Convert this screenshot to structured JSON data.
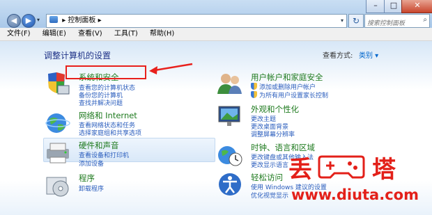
{
  "window": {
    "address_path": "控制面板",
    "search_placeholder": "搜索控制面板"
  },
  "menubar": [
    "文件(F)",
    "编辑(E)",
    "查看(V)",
    "工具(T)",
    "帮助(H)"
  ],
  "page": {
    "heading": "调整计算机的设置",
    "view_by_label": "查看方式:",
    "view_by_value": "类别 ▾"
  },
  "categories": [
    {
      "title": "系统和安全",
      "links": [
        "查看您的计算机状态",
        "备份您的计算机",
        "查找并解决问题"
      ]
    },
    {
      "title": "网络和 Internet",
      "links": [
        "查看网络状态和任务",
        "选择家庭组和共享选项"
      ]
    },
    {
      "title": "硬件和声音",
      "links": [
        "查看设备和打印机",
        "添加设备"
      ]
    },
    {
      "title": "程序",
      "links": [
        "卸载程序"
      ]
    },
    {
      "title": "用户帐户和家庭安全",
      "links": [
        "添加或删除用户帐户",
        "为所有用户设置家长控制"
      ]
    },
    {
      "title": "外观和个性化",
      "links": [
        "更改主题",
        "更改桌面背景",
        "调整屏幕分辨率"
      ]
    },
    {
      "title": "时钟、语言和区域",
      "links": [
        "更改键盘或其他输入法",
        "更改显示语言"
      ]
    },
    {
      "title": "轻松访问",
      "links": [
        "使用 Windows 建议的设置",
        "优化视觉显示"
      ]
    }
  ],
  "watermark": {
    "brand_left": "丢",
    "brand_right": "塔",
    "url": "www.diuta.com"
  },
  "colors": {
    "category_title": "#1e7a1e",
    "link": "#2a5dbd",
    "heading": "#1e3287",
    "annotation": "#e8201c"
  }
}
